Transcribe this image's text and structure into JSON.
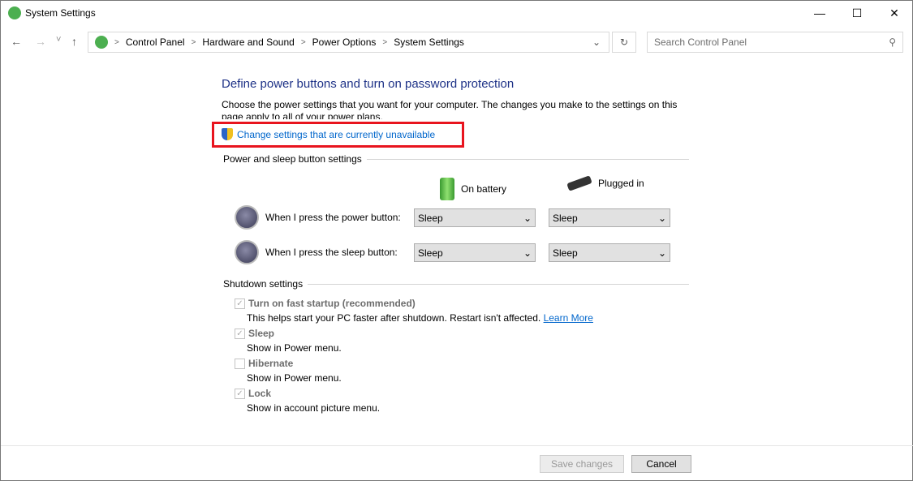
{
  "window": {
    "title": "System Settings",
    "minimize": "—",
    "maximize": "☐",
    "close": "✕"
  },
  "nav": {
    "back": "←",
    "forward": "→",
    "recent": "˅",
    "up": "↑"
  },
  "breadcrumb": [
    "Control Panel",
    "Hardware and Sound",
    "Power Options",
    "System Settings"
  ],
  "search": {
    "placeholder": "Search Control Panel"
  },
  "page": {
    "title": "Define power buttons and turn on password protection",
    "description": "Choose the power settings that you want for your computer. The changes you make to the settings on this page apply to all of your power plans.",
    "change_link": "Change settings that are currently unavailable",
    "power_group": "Power and sleep button settings",
    "col_battery": "On battery",
    "col_plugged": "Plugged in",
    "rows": [
      {
        "label": "When I press the power button:",
        "battery": "Sleep",
        "plugged": "Sleep"
      },
      {
        "label": "When I press the sleep button:",
        "battery": "Sleep",
        "plugged": "Sleep"
      }
    ],
    "shutdown_group": "Shutdown settings",
    "options": [
      {
        "label": "Turn on fast startup (recommended)",
        "checked": true,
        "desc": "This helps start your PC faster after shutdown. Restart isn't affected.",
        "link": "Learn More"
      },
      {
        "label": "Sleep",
        "checked": true,
        "desc": "Show in Power menu."
      },
      {
        "label": "Hibernate",
        "checked": false,
        "desc": "Show in Power menu."
      },
      {
        "label": "Lock",
        "checked": true,
        "desc": "Show in account picture menu."
      }
    ]
  },
  "footer": {
    "save": "Save changes",
    "cancel": "Cancel"
  }
}
